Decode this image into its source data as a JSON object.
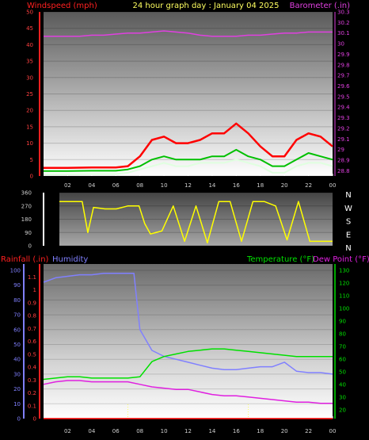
{
  "header": {
    "left_title": "Windspeed (mph)",
    "center_title": "24 hour graph day : January 04 2025",
    "right_title": "Barometer (.in)"
  },
  "colors": {
    "windspeed": "#ff0000",
    "wind_avg": "#00c000",
    "wind_low": "#e0ffe0",
    "barometer": "#e040e0",
    "direction": "#ffff00",
    "humidity": "#8080ff",
    "temperature": "#00e000",
    "dewpoint": "#e020e0",
    "rainfall": "#ff0000"
  },
  "chart_data": [
    {
      "type": "line",
      "name": "wind-barometer",
      "x_ticks": [
        "02",
        "04",
        "06",
        "08",
        "10",
        "12",
        "14",
        "16",
        "18",
        "20",
        "22",
        "00"
      ],
      "y_left_ticks": [
        "0",
        "5",
        "10",
        "15",
        "20",
        "25",
        "30",
        "35",
        "40",
        "45",
        "50"
      ],
      "y_left_lim": [
        0,
        50
      ],
      "y_right_ticks": [
        "28.8",
        "28.9",
        "29",
        "29.1",
        "29.2",
        "29.3",
        "29.4",
        "29.5",
        "29.6",
        "29.7",
        "29.8",
        "29.9",
        "30",
        "30.1",
        "30.2",
        "30.3"
      ],
      "y_right_lim": [
        28.75,
        30.3
      ],
      "series": [
        {
          "x": [
            0,
            2,
            4,
            6,
            7,
            8,
            9,
            10,
            11,
            12,
            13,
            14,
            15,
            16,
            17,
            18,
            19,
            20,
            21,
            22,
            23,
            24
          ],
          "values": [
            2.5,
            2.5,
            2.6,
            2.6,
            3,
            6,
            11,
            12,
            10,
            10,
            11,
            13,
            13,
            16,
            13,
            9,
            6,
            6,
            11,
            13,
            12,
            9
          ]
        },
        {
          "x": [
            0,
            2,
            4,
            6,
            7,
            8,
            9,
            10,
            11,
            12,
            13,
            14,
            15,
            16,
            17,
            18,
            19,
            20,
            21,
            22,
            23,
            24
          ],
          "values": [
            1.5,
            1.5,
            1.6,
            1.6,
            2,
            3,
            5,
            6,
            5,
            5,
            5,
            6,
            6,
            8,
            6,
            5,
            3,
            3,
            5,
            7,
            6,
            5
          ]
        },
        {
          "x": [
            0,
            2,
            4,
            6,
            7,
            8,
            9,
            10,
            11,
            12,
            13,
            14,
            15,
            16,
            17,
            18,
            19,
            20,
            21,
            22,
            23,
            24
          ],
          "values": [
            0.5,
            0.5,
            0.6,
            0.6,
            1,
            2,
            3,
            4,
            3,
            3,
            4,
            4,
            4,
            5,
            4,
            3,
            1,
            1,
            3,
            4,
            4,
            3
          ]
        },
        {
          "x": [
            0,
            1,
            2,
            3,
            4,
            5,
            6,
            7,
            8,
            9,
            10,
            11,
            12,
            13,
            14,
            15,
            16,
            17,
            18,
            19,
            20,
            21,
            22,
            23,
            24
          ],
          "values": [
            30.07,
            30.07,
            30.07,
            30.07,
            30.08,
            30.08,
            30.09,
            30.1,
            30.1,
            30.11,
            30.12,
            30.11,
            30.1,
            30.08,
            30.07,
            30.07,
            30.07,
            30.08,
            30.08,
            30.09,
            30.1,
            30.1,
            30.11,
            30.11,
            30.11
          ]
        }
      ]
    },
    {
      "type": "line",
      "name": "wind-direction",
      "x_ticks": [
        "02",
        "04",
        "06",
        "08",
        "10",
        "12",
        "14",
        "16",
        "18",
        "20",
        "22",
        "00"
      ],
      "y_ticks": [
        "0",
        "90",
        "180",
        "270",
        "360"
      ],
      "ylim": [
        0,
        360
      ],
      "compass_labels": [
        "N",
        "W",
        "S",
        "E",
        "N"
      ],
      "series": [
        {
          "x": [
            0,
            1,
            2,
            2.5,
            3,
            4,
            5,
            6,
            7,
            7.5,
            8,
            9,
            10,
            11,
            12,
            13,
            14,
            15,
            16,
            17,
            18,
            19,
            20,
            21,
            22,
            23,
            24
          ],
          "values": [
            300,
            300,
            300,
            90,
            260,
            250,
            250,
            270,
            270,
            150,
            80,
            100,
            270,
            30,
            270,
            20,
            300,
            300,
            30,
            300,
            300,
            270,
            40,
            300,
            30,
            30,
            30
          ]
        }
      ]
    },
    {
      "type": "line",
      "name": "humidity-temperature-rain",
      "x_ticks": [
        "02",
        "04",
        "06",
        "08",
        "10",
        "12",
        "14",
        "16",
        "18",
        "20",
        "22",
        "00"
      ],
      "left_outer_ticks": [
        "0",
        "0.1",
        "0.2",
        "0.3",
        "0.4",
        "0.5",
        "0.6",
        "0.7",
        "0.8",
        "0.9",
        "1",
        "1.1"
      ],
      "left_outer_lim": [
        0,
        1.2
      ],
      "left_inner_ticks": [
        "0",
        "10",
        "20",
        "30",
        "40",
        "50",
        "60",
        "70",
        "80",
        "90",
        "100"
      ],
      "left_inner_lim": [
        0,
        100
      ],
      "right_ticks": [
        "20",
        "30",
        "40",
        "50",
        "60",
        "70",
        "80",
        "90",
        "100",
        "110",
        "120",
        "130"
      ],
      "right_lim": [
        13,
        135
      ],
      "labels": {
        "rainfall": "Rainfall (.in)",
        "humidity": "Humidity",
        "temperature": "Temperature (°F)",
        "dewpoint": "Dew Point (°F)"
      },
      "series": [
        {
          "x": [
            0,
            1,
            2,
            3,
            4,
            5,
            6,
            7,
            7.5,
            8,
            9,
            10,
            11,
            12,
            13,
            14,
            15,
            16,
            17,
            18,
            19,
            20,
            21,
            22,
            23,
            24
          ],
          "values": [
            92,
            95,
            96,
            97,
            97,
            98,
            98,
            98,
            98,
            60,
            46,
            42,
            40,
            38,
            36,
            34,
            33,
            33,
            34,
            35,
            35,
            38,
            32,
            31,
            31,
            30
          ]
        },
        {
          "x": [
            0,
            1,
            2,
            3,
            4,
            5,
            6,
            7,
            8,
            9,
            10,
            11,
            12,
            13,
            14,
            15,
            16,
            17,
            18,
            19,
            20,
            21,
            22,
            23,
            24
          ],
          "values": [
            44,
            45,
            46,
            46,
            45,
            45,
            45,
            45,
            46,
            58,
            62,
            64,
            66,
            67,
            68,
            68,
            67,
            66,
            65,
            64,
            63,
            62,
            62,
            62,
            62
          ]
        },
        {
          "x": [
            0,
            1,
            2,
            3,
            4,
            5,
            6,
            7,
            8,
            9,
            10,
            11,
            12,
            13,
            14,
            15,
            16,
            17,
            18,
            19,
            20,
            21,
            22,
            23,
            24
          ],
          "values": [
            40,
            42,
            43,
            43,
            42,
            42,
            42,
            42,
            40,
            38,
            37,
            36,
            36,
            34,
            32,
            31,
            31,
            30,
            29,
            28,
            27,
            26,
            26,
            25,
            25
          ]
        },
        {
          "x": [
            0,
            24
          ],
          "values": [
            0,
            0
          ]
        }
      ]
    }
  ]
}
